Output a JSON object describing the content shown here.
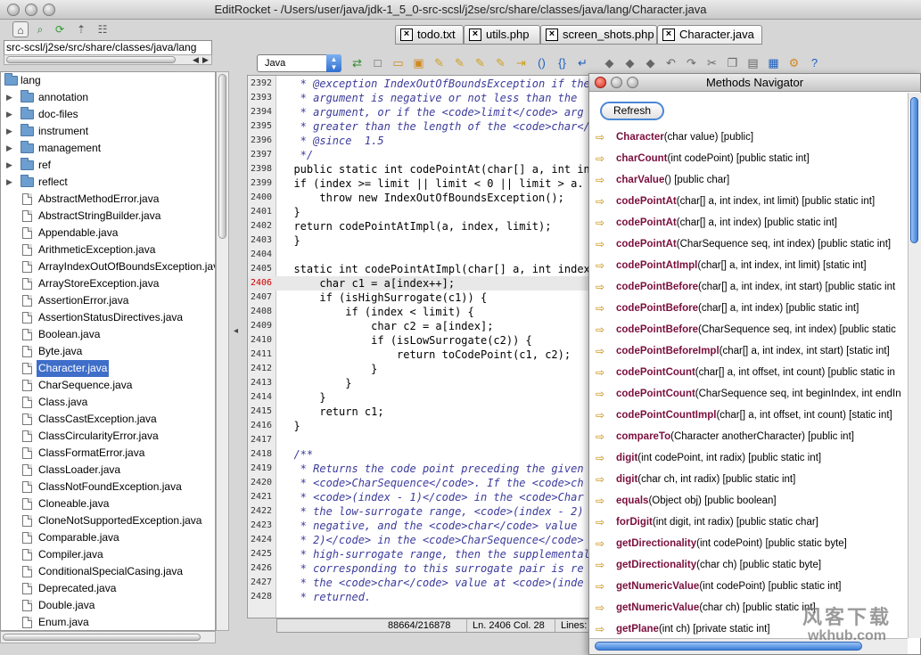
{
  "window": {
    "title": "EditRocket - /Users/user/java/jdk-1_5_0-src-scsl/j2se/src/share/classes/java/lang/Character.java"
  },
  "sidebar": {
    "path": "src-scsl/j2se/src/share/classes/java/lang",
    "root": "lang",
    "folders": [
      "annotation",
      "doc-files",
      "instrument",
      "management",
      "ref",
      "reflect"
    ],
    "files": [
      "AbstractMethodError.java",
      "AbstractStringBuilder.java",
      "Appendable.java",
      "ArithmeticException.java",
      "ArrayIndexOutOfBoundsException.java",
      "ArrayStoreException.java",
      "AssertionError.java",
      "AssertionStatusDirectives.java",
      "Boolean.java",
      "Byte.java",
      "Character.java",
      "CharSequence.java",
      "Class.java",
      "ClassCastException.java",
      "ClassCircularityError.java",
      "ClassFormatError.java",
      "ClassLoader.java",
      "ClassNotFoundException.java",
      "Cloneable.java",
      "CloneNotSupportedException.java",
      "Comparable.java",
      "Compiler.java",
      "ConditionalSpecialCasing.java",
      "Deprecated.java",
      "Double.java",
      "Enum.java"
    ],
    "selected_file": "Character.java"
  },
  "tabs": [
    {
      "label": "todo.txt"
    },
    {
      "label": "utils.php"
    },
    {
      "label": "screen_shots.php"
    },
    {
      "label": "Character.java"
    }
  ],
  "editor": {
    "language": "Java",
    "current_line": "2406",
    "lines": [
      {
        "n": "2392",
        "t": "   * @exception IndexOutOfBoundsException if the",
        "k": "comment"
      },
      {
        "n": "2393",
        "t": "   * argument is negative or not less than the",
        "k": "comment"
      },
      {
        "n": "2394",
        "t": "   * argument, or if the <code>limit</code> arg",
        "k": "comment"
      },
      {
        "n": "2395",
        "t": "   * greater than the length of the <code>char</c",
        "k": "comment"
      },
      {
        "n": "2396",
        "t": "   * @since  1.5",
        "k": "comment"
      },
      {
        "n": "2397",
        "t": "   */",
        "k": "comment"
      },
      {
        "n": "2398",
        "t": "  public static int codePointAt(char[] a, int in",
        "k": "code"
      },
      {
        "n": "2399",
        "t": "  if (index >= limit || limit < 0 || limit > a.",
        "k": "code"
      },
      {
        "n": "2400",
        "t": "      throw new IndexOutOfBoundsException();",
        "k": "code"
      },
      {
        "n": "2401",
        "t": "  }",
        "k": "code"
      },
      {
        "n": "2402",
        "t": "  return codePointAtImpl(a, index, limit);",
        "k": "code"
      },
      {
        "n": "2403",
        "t": "  }",
        "k": "code"
      },
      {
        "n": "2404",
        "t": "",
        "k": "code"
      },
      {
        "n": "2405",
        "t": "  static int codePointAtImpl(char[] a, int index",
        "k": "code"
      },
      {
        "n": "2406",
        "t": "      char c1 = a[index++];",
        "k": "code"
      },
      {
        "n": "2407",
        "t": "      if (isHighSurrogate(c1)) {",
        "k": "code"
      },
      {
        "n": "2408",
        "t": "          if (index < limit) {",
        "k": "code"
      },
      {
        "n": "2409",
        "t": "              char c2 = a[index];",
        "k": "code"
      },
      {
        "n": "2410",
        "t": "              if (isLowSurrogate(c2)) {",
        "k": "code"
      },
      {
        "n": "2411",
        "t": "                  return toCodePoint(c1, c2);",
        "k": "code"
      },
      {
        "n": "2412",
        "t": "              }",
        "k": "code"
      },
      {
        "n": "2413",
        "t": "          }",
        "k": "code"
      },
      {
        "n": "2414",
        "t": "      }",
        "k": "code"
      },
      {
        "n": "2415",
        "t": "      return c1;",
        "k": "code"
      },
      {
        "n": "2416",
        "t": "  }",
        "k": "code"
      },
      {
        "n": "2417",
        "t": "",
        "k": "code"
      },
      {
        "n": "2418",
        "t": "  /**",
        "k": "comment"
      },
      {
        "n": "2419",
        "t": "   * Returns the code point preceding the given",
        "k": "comment"
      },
      {
        "n": "2420",
        "t": "   * <code>CharSequence</code>. If the <code>ch",
        "k": "comment"
      },
      {
        "n": "2421",
        "t": "   * <code>(index - 1)</code> in the <code>Char",
        "k": "comment"
      },
      {
        "n": "2422",
        "t": "   * the low-surrogate range, <code>(index - 2)",
        "k": "comment"
      },
      {
        "n": "2423",
        "t": "   * negative, and the <code>char</code> value",
        "k": "comment"
      },
      {
        "n": "2424",
        "t": "   * 2)</code> in the <code>CharSequence</code>",
        "k": "comment"
      },
      {
        "n": "2425",
        "t": "   * high-surrogate range, then the supplemental",
        "k": "comment"
      },
      {
        "n": "2426",
        "t": "   * corresponding to this surrogate pair is re",
        "k": "comment"
      },
      {
        "n": "2427",
        "t": "   * the <code>char</code> value at <code>(inde",
        "k": "comment"
      },
      {
        "n": "2428",
        "t": "   * returned.",
        "k": "comment"
      }
    ]
  },
  "status": {
    "position": "88664/216878",
    "line_col": "Ln. 2406 Col. 28",
    "lines_label": "Lines:"
  },
  "navigator": {
    "title": "Methods Navigator",
    "refresh_label": "Refresh",
    "methods": [
      {
        "name": "Character",
        "sig": "(char value) [public]"
      },
      {
        "name": "charCount",
        "sig": "(int codePoint) [public static int]"
      },
      {
        "name": "charValue",
        "sig": "() [public char]"
      },
      {
        "name": "codePointAt",
        "sig": "(char[] a, int index, int limit) [public static int]"
      },
      {
        "name": "codePointAt",
        "sig": "(char[] a, int index) [public static int]"
      },
      {
        "name": "codePointAt",
        "sig": "(CharSequence seq, int index) [public static int]"
      },
      {
        "name": "codePointAtImpl",
        "sig": "(char[] a, int index, int limit) [static int]"
      },
      {
        "name": "codePointBefore",
        "sig": "(char[] a, int index, int start) [public static int"
      },
      {
        "name": "codePointBefore",
        "sig": "(char[] a, int index) [public static int]"
      },
      {
        "name": "codePointBefore",
        "sig": "(CharSequence seq, int index) [public static"
      },
      {
        "name": "codePointBeforeImpl",
        "sig": "(char[] a, int index, int start) [static int]"
      },
      {
        "name": "codePointCount",
        "sig": "(char[] a, int offset, int count) [public static in"
      },
      {
        "name": "codePointCount",
        "sig": "(CharSequence seq, int beginIndex, int endIn"
      },
      {
        "name": "codePointCountImpl",
        "sig": "(char[] a, int offset, int count) [static int]"
      },
      {
        "name": "compareTo",
        "sig": "(Character anotherCharacter) [public int]"
      },
      {
        "name": "digit",
        "sig": "(int codePoint, int radix) [public static int]"
      },
      {
        "name": "digit",
        "sig": "(char ch, int radix) [public static int]"
      },
      {
        "name": "equals",
        "sig": "(Object obj) [public boolean]"
      },
      {
        "name": "forDigit",
        "sig": "(int digit, int radix) [public static char]"
      },
      {
        "name": "getDirectionality",
        "sig": "(int codePoint) [public static byte]"
      },
      {
        "name": "getDirectionality",
        "sig": "(char ch) [public static byte]"
      },
      {
        "name": "getNumericValue",
        "sig": "(int codePoint) [public static int]"
      },
      {
        "name": "getNumericValue",
        "sig": "(char ch) [public static int]"
      },
      {
        "name": "getPlane",
        "sig": "(int ch) [private static int]"
      }
    ]
  },
  "watermark": {
    "line1": "风客下载",
    "line2": "wkhub.com"
  },
  "colors": {
    "selection": "#3f6ec9",
    "method_name": "#7a0f3d",
    "comment": "#3b3b9c",
    "current_line_number": "#d00000"
  }
}
